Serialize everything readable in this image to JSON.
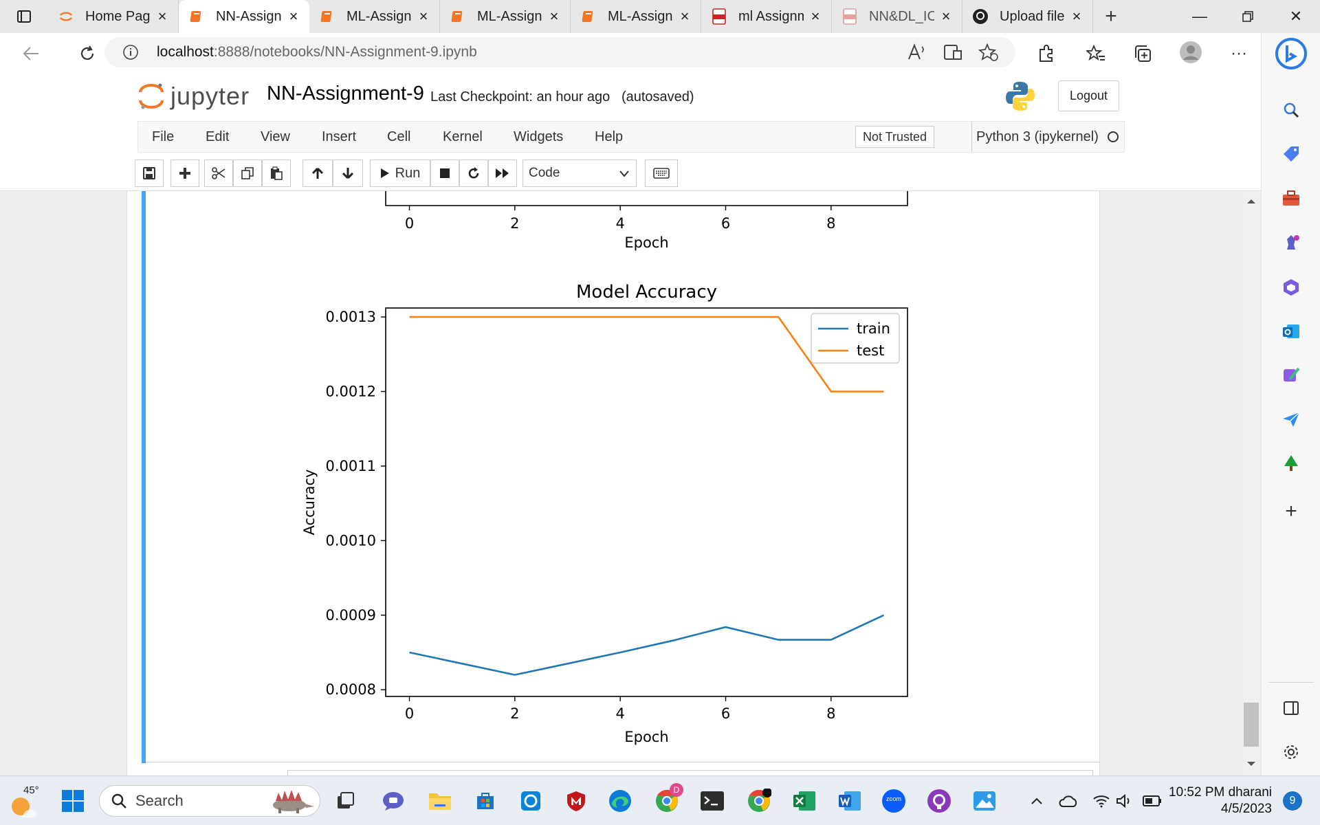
{
  "browser": {
    "tabs": [
      {
        "label": "Home Page",
        "icon": "jupyter-icon",
        "active": false
      },
      {
        "label": "NN-Assignm",
        "icon": "notebook-icon",
        "active": true
      },
      {
        "label": "ML-Assignm",
        "icon": "notebook-icon",
        "active": false
      },
      {
        "label": "ML-Assignm",
        "icon": "notebook-icon",
        "active": false
      },
      {
        "label": "ML-Assignm",
        "icon": "notebook-icon",
        "active": false
      },
      {
        "label": "ml Assignm",
        "icon": "pdf-icon",
        "active": false
      },
      {
        "label": "NN&DL_IC",
        "icon": "pdf-icon",
        "active": false
      },
      {
        "label": "Upload file",
        "icon": "github-icon",
        "active": false
      }
    ],
    "url_host": "localhost",
    "url_path": ":8888/notebooks/NN-Assignment-9.ipynb"
  },
  "jupyter": {
    "logo_text": "jupyter",
    "notebook_name": "NN-Assignment-9",
    "checkpoint": "Last Checkpoint: an hour ago",
    "autosave": "(autosaved)",
    "logout_label": "Logout",
    "menus": [
      "File",
      "Edit",
      "View",
      "Insert",
      "Cell",
      "Kernel",
      "Widgets",
      "Help"
    ],
    "trust_label": "Not Trusted",
    "kernel_name": "Python 3 (ipykernel)",
    "run_label": "Run",
    "cell_type": "Code"
  },
  "chart_data": [
    {
      "type": "line",
      "title": "",
      "xlabel": "Epoch",
      "ylabel": "",
      "x_ticks": [
        0,
        2,
        4,
        6,
        8
      ],
      "partially_visible": true
    },
    {
      "type": "line",
      "title": "Model Accuracy",
      "xlabel": "Epoch",
      "ylabel": "Accuracy",
      "x": [
        0,
        1,
        2,
        3,
        4,
        5,
        6,
        7,
        8,
        9
      ],
      "series": [
        {
          "name": "train",
          "color": "#1f77b4",
          "values": [
            0.00085,
            0.000835,
            0.00082,
            0.000835,
            0.00085,
            0.000866,
            0.000884,
            0.000867,
            0.000867,
            0.0009
          ]
        },
        {
          "name": "test",
          "color": "#ff7f0e",
          "values": [
            0.0013,
            0.0013,
            0.0013,
            0.0013,
            0.0013,
            0.0013,
            0.0013,
            0.0013,
            0.0012,
            0.0012
          ]
        }
      ],
      "x_ticks": [
        0,
        2,
        4,
        6,
        8
      ],
      "y_ticks": [
        "0.0008",
        "0.0009",
        "0.0010",
        "0.0011",
        "0.0012",
        "0.0013"
      ],
      "xlim": [
        -0.45,
        9.45
      ],
      "ylim": [
        0.000791,
        0.001312
      ],
      "legend": "top-right",
      "grid": false
    }
  ],
  "taskbar": {
    "temperature": "45°",
    "search_label": "Search",
    "time": "10:52 PM",
    "user": "dharani",
    "date": "4/5/2023",
    "notification_count": "9",
    "chrome_badge": "D",
    "zoom_label": "zoom"
  }
}
